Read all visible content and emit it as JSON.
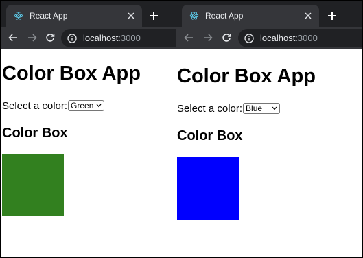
{
  "windows": [
    {
      "tab": {
        "title": "React App",
        "favicon": "react-logo-icon"
      },
      "address": {
        "host": "localhost",
        "port": ":3000"
      },
      "page": {
        "heading": "Color Box App",
        "select_label": "Select a color:",
        "selected_color": "Green",
        "subheading": "Color Box",
        "box_color": "#32801f"
      }
    },
    {
      "tab": {
        "title": "React App",
        "favicon": "react-logo-icon"
      },
      "address": {
        "host": "localhost",
        "port": ":3000"
      },
      "page": {
        "heading": "Color Box App",
        "select_label": "Select a color:",
        "selected_color": "Blue",
        "subheading": "Color Box",
        "box_color": "#0000ff"
      }
    }
  ],
  "colors": {
    "tabstrip": "#202124",
    "active_tab": "#35363a",
    "omnibox": "#202124",
    "tab_text": "#e8eaed",
    "muted_text": "#9aa0a6"
  }
}
